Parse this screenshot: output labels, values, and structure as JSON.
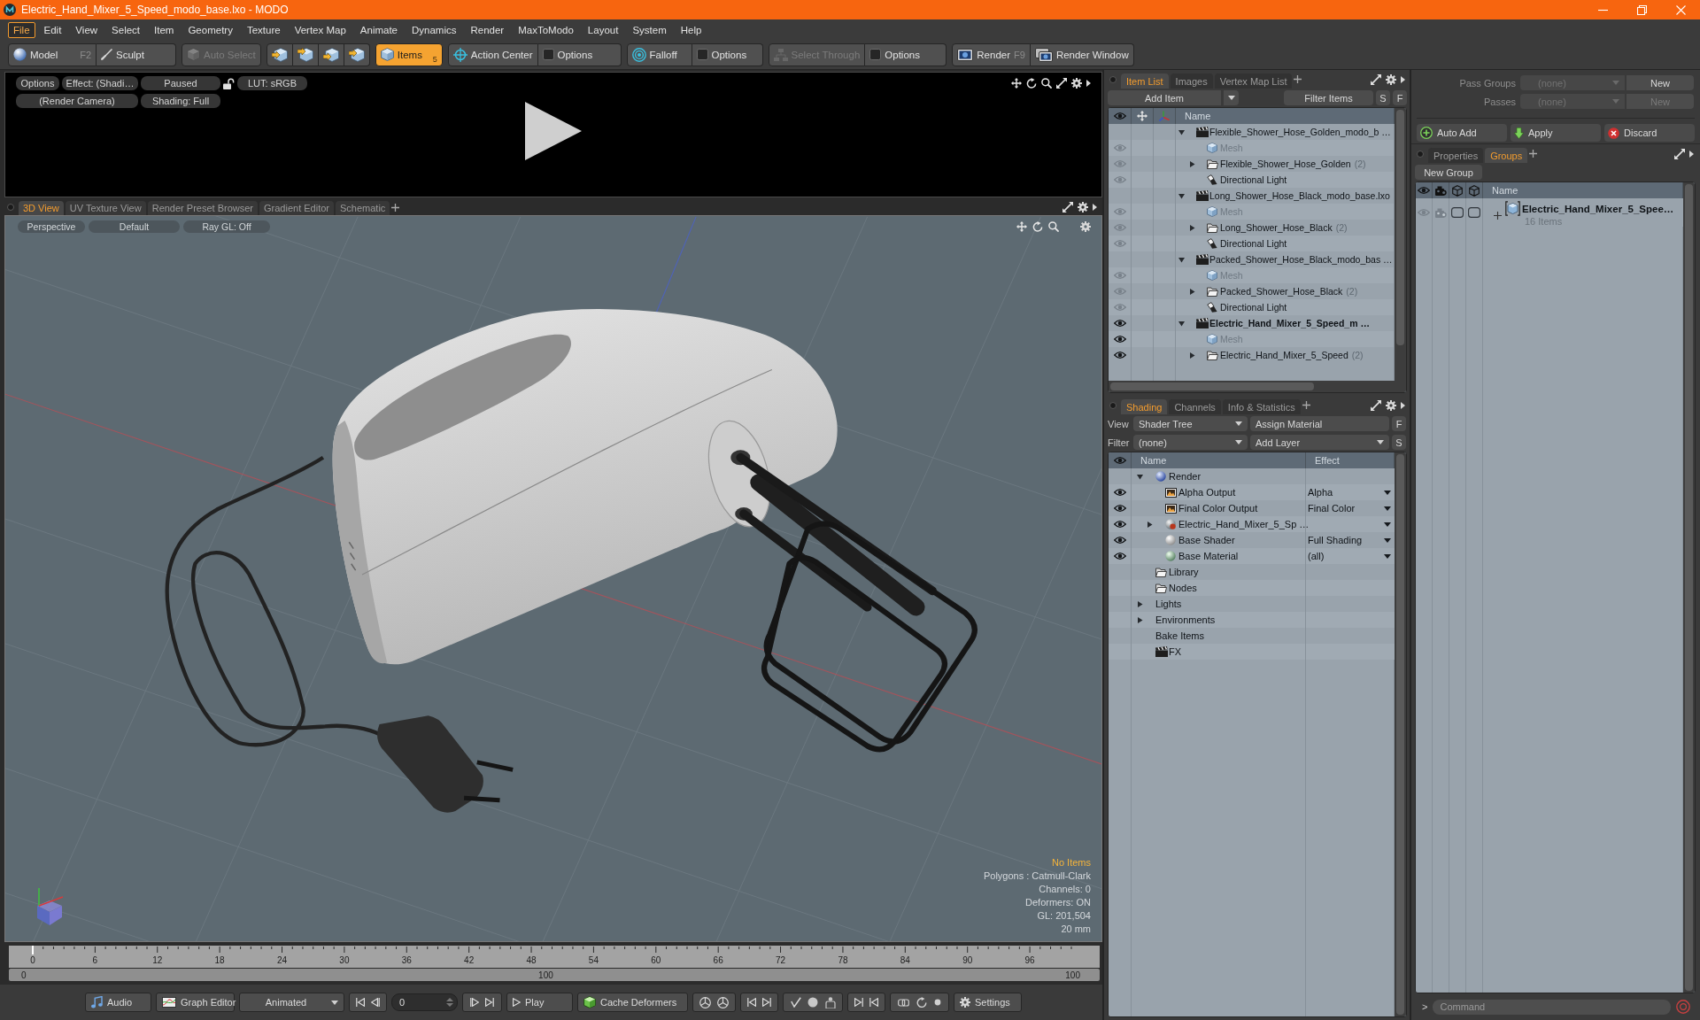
{
  "window": {
    "title": "Electric_Hand_Mixer_5_Speed_modo_base.lxo - MODO"
  },
  "menu": [
    {
      "label": "File",
      "selected": true
    },
    {
      "label": "Edit",
      "selected": false
    },
    {
      "label": "View",
      "selected": false
    },
    {
      "label": "Select",
      "selected": false
    },
    {
      "label": "Item",
      "selected": false
    },
    {
      "label": "Geometry",
      "selected": false
    },
    {
      "label": "Texture",
      "selected": false
    },
    {
      "label": "Vertex Map",
      "selected": false
    },
    {
      "label": "Animate",
      "selected": false
    },
    {
      "label": "Dynamics",
      "selected": false
    },
    {
      "label": "Render",
      "selected": false
    },
    {
      "label": "MaxToModo",
      "selected": false
    },
    {
      "label": "Layout",
      "selected": false
    },
    {
      "label": "System",
      "selected": false
    },
    {
      "label": "Help",
      "selected": false
    }
  ],
  "toolbar": {
    "groups": [
      {
        "buttons": [
          {
            "label": "Model",
            "shortcut": "F2",
            "selected": false,
            "disabled": false
          },
          {
            "label": "Sculpt",
            "selected": false,
            "disabled": false
          }
        ]
      },
      {
        "buttons": [
          {
            "label": "Auto Select",
            "selected": false,
            "disabled": true
          }
        ]
      },
      {
        "buttons": [
          {
            "selected": false,
            "disabled": false
          },
          {
            "selected": false,
            "disabled": false
          },
          {
            "selected": false,
            "disabled": false
          },
          {
            "selected": false,
            "disabled": false
          }
        ]
      },
      {
        "buttons": [
          {
            "label": "Items",
            "shortcut": "5",
            "selected": true,
            "disabled": false
          }
        ]
      },
      {
        "buttons": [
          {
            "label": "Action Center",
            "selected": false,
            "disabled": false
          },
          {
            "label": "Options",
            "selected": false,
            "disabled": false
          }
        ]
      },
      {
        "buttons": [
          {
            "label": "Falloff",
            "selected": false,
            "disabled": false
          },
          {
            "label": "Options",
            "selected": false,
            "disabled": false
          }
        ]
      },
      {
        "buttons": [
          {
            "label": "Select Through",
            "selected": false,
            "disabled": true
          },
          {
            "label": "Options",
            "selected": false,
            "disabled": false
          }
        ]
      },
      {
        "buttons": [
          {
            "label": "Render",
            "shortcut": "F9",
            "selected": false,
            "disabled": false
          },
          {
            "label": "Render Window",
            "selected": false,
            "disabled": false
          }
        ]
      }
    ]
  },
  "render_view": {
    "controls": [
      {
        "kind": "button",
        "label": "Options"
      },
      {
        "kind": "button",
        "label": "Effect: (Shadi…"
      },
      {
        "kind": "button",
        "label": "Paused"
      },
      {
        "kind": "lock",
        "locked": false
      },
      {
        "kind": "button",
        "label": "LUT: sRGB"
      },
      {
        "kind": "button",
        "label": "(Render Camera)"
      },
      {
        "kind": "button",
        "label": "Shading: Full"
      }
    ]
  },
  "view_tabs": [
    {
      "label": "3D View",
      "selected": true
    },
    {
      "label": "UV Texture View",
      "selected": false
    },
    {
      "label": "Render Preset Browser",
      "selected": false
    },
    {
      "label": "Gradient Editor",
      "selected": false
    },
    {
      "label": "Schematic",
      "selected": false
    }
  ],
  "viewport": {
    "controls": [
      "Perspective",
      "Default",
      "Ray GL: Off"
    ],
    "stats": [
      {
        "kind": "highlight",
        "text": "No Items"
      },
      {
        "kind": "info",
        "text": "Polygons : Catmull-Clark"
      },
      {
        "kind": "info",
        "text": "Channels: 0"
      },
      {
        "kind": "info",
        "text": "Deformers: ON"
      },
      {
        "kind": "info",
        "text": "GL: 201,504"
      },
      {
        "kind": "info",
        "text": "20 mm"
      }
    ]
  },
  "timeline": {
    "ticks": [
      "0",
      "6",
      "12",
      "18",
      "24",
      "30",
      "36",
      "42",
      "48",
      "54",
      "60",
      "66",
      "72",
      "78",
      "84",
      "90",
      "96"
    ],
    "range": [
      "0",
      "100",
      "100"
    ]
  },
  "transport": {
    "audio": "Audio",
    "graph_editor": "Graph Editor",
    "mode": "Animated",
    "frame": "0",
    "play": "Play",
    "cache": "Cache Deformers",
    "settings": "Settings"
  },
  "item_list": {
    "tabs": [
      {
        "label": "Item List",
        "selected": true
      },
      {
        "label": "Images",
        "selected": false
      },
      {
        "label": "Vertex Map List",
        "selected": false
      }
    ],
    "add_item": "Add Item",
    "filter": "Filter Items",
    "keys": [
      "S",
      "F"
    ],
    "column": "Name",
    "items": [
      {
        "kind": "scene",
        "name": "Flexible_Shower_Hose_Golden_modo_b …",
        "active": false,
        "visible": false,
        "expanded": true,
        "children": [
          {
            "kind": "mesh",
            "name": "Mesh",
            "visible": true
          },
          {
            "kind": "group",
            "name": "Flexible_Shower_Hose_Golden",
            "count": "(2)",
            "visible": true,
            "expanded": false
          },
          {
            "kind": "light",
            "name": "Directional Light",
            "visible": true
          }
        ]
      },
      {
        "kind": "scene",
        "name": "Long_Shower_Hose_Black_modo_base.lxo",
        "active": false,
        "visible": false,
        "expanded": true,
        "children": [
          {
            "kind": "mesh",
            "name": "Mesh",
            "visible": true
          },
          {
            "kind": "group",
            "name": "Long_Shower_Hose_Black",
            "count": "(2)",
            "visible": true,
            "expanded": false
          },
          {
            "kind": "light",
            "name": "Directional Light",
            "visible": true
          }
        ]
      },
      {
        "kind": "scene",
        "name": "Packed_Shower_Hose_Black_modo_bas …",
        "active": false,
        "visible": false,
        "expanded": true,
        "children": [
          {
            "kind": "mesh",
            "name": "Mesh",
            "visible": true
          },
          {
            "kind": "group",
            "name": "Packed_Shower_Hose_Black",
            "count": "(2)",
            "visible": true,
            "expanded": false
          },
          {
            "kind": "light",
            "name": "Directional Light",
            "visible": true
          }
        ]
      },
      {
        "kind": "scene",
        "name": "Electric_Hand_Mixer_5_Speed_m …",
        "active": true,
        "visible": true,
        "expanded": true,
        "children": [
          {
            "kind": "mesh",
            "name": "Mesh",
            "visible": true
          },
          {
            "kind": "group",
            "name": "Electric_Hand_Mixer_5_Speed",
            "count": "(2)",
            "visible": true,
            "expanded": false
          }
        ]
      }
    ]
  },
  "shading": {
    "tabs": [
      {
        "label": "Shading",
        "selected": true
      },
      {
        "label": "Channels",
        "selected": false
      },
      {
        "label": "Info & Statistics",
        "selected": false
      }
    ],
    "view": {
      "label": "View",
      "value": "Shader Tree",
      "button": "Assign Material",
      "key": "F"
    },
    "filter": {
      "label": "Filter",
      "value": "(none)",
      "button": "Add Layer",
      "key": "S"
    },
    "columns": [
      "Name",
      "Effect"
    ],
    "items": [
      {
        "kind": "render",
        "name": "Render",
        "visible": false,
        "expanded": true,
        "children": [
          {
            "kind": "output",
            "name": "Alpha Output",
            "effect": "Alpha",
            "visible": true
          },
          {
            "kind": "output",
            "name": "Final Color Output",
            "effect": "Final Color",
            "visible": true
          },
          {
            "kind": "material_group",
            "name": "Electric_Hand_Mixer_5_Sp …",
            "visible": true,
            "expanded": false
          },
          {
            "kind": "shader",
            "name": "Base Shader",
            "effect": "Full Shading",
            "visible": true
          },
          {
            "kind": "material",
            "name": "Base Material",
            "effect": "(all)",
            "visible": true
          }
        ]
      },
      {
        "kind": "folder",
        "name": "Library",
        "visible": false
      },
      {
        "kind": "folder",
        "name": "Nodes",
        "visible": false
      },
      {
        "kind": "category",
        "name": "Lights",
        "visible": false,
        "expanded": false
      },
      {
        "kind": "category",
        "name": "Environments",
        "visible": false,
        "expanded": false
      },
      {
        "kind": "plain",
        "name": "Bake Items",
        "visible": false
      },
      {
        "kind": "fx",
        "name": "FX",
        "visible": false
      }
    ]
  },
  "passes": {
    "rows": [
      {
        "label": "Pass Groups",
        "value": "(none)",
        "button": "New",
        "disabled": false
      },
      {
        "label": "Passes",
        "value": "(none)",
        "button": "New",
        "disabled": true
      }
    ],
    "actions": [
      {
        "kind": "add",
        "label": "Auto Add"
      },
      {
        "kind": "apply",
        "label": "Apply"
      },
      {
        "kind": "discard",
        "label": "Discard"
      }
    ]
  },
  "groups": {
    "tabs": [
      {
        "label": "Properties",
        "selected": false
      },
      {
        "label": "Groups",
        "selected": true
      }
    ],
    "new_group": "New Group",
    "column": "Name",
    "items": [
      {
        "name": "Electric_Hand_Mixer_5_Spee…",
        "count": "16 Items",
        "expanded": false,
        "flags": [
          {
            "checked": false
          },
          {
            "checked": false
          }
        ]
      }
    ]
  },
  "command": {
    "prompt": ">",
    "placeholder": "Command"
  }
}
